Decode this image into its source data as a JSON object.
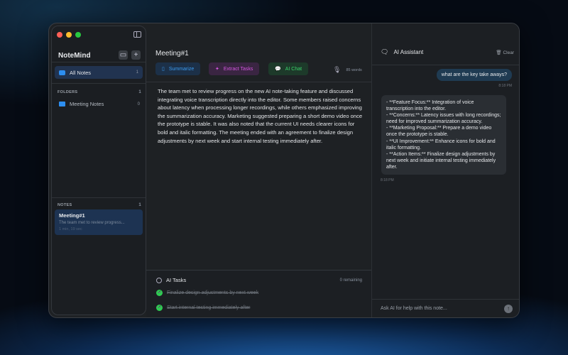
{
  "sidebar": {
    "app_name": "NoteMind",
    "all_notes": {
      "label": "All Notes",
      "count": "1"
    },
    "folders_header": "FOLDERS",
    "folders_count": "1",
    "folders": [
      {
        "label": "Meeting Notes",
        "count": "0"
      }
    ],
    "notes_header": "NOTES",
    "notes_count": "1",
    "notes": [
      {
        "title": "Meeting#1",
        "preview": "The team met to review progress...",
        "duration": "1 min, 19 sec"
      }
    ]
  },
  "main": {
    "title": "Meeting#1",
    "toolbar": {
      "summarize": "Summarize",
      "extract": "Extract Tasks",
      "chat": "AI Chat",
      "words": "85 words"
    },
    "body": "The team met to review progress on the new AI note-taking feature and discussed integrating voice transcription directly into the editor. Some members raised concerns about latency when processing longer recordings, while others emphasized improving the summarization accuracy. Marketing suggested preparing a short demo video once the prototype is stable. It was also noted that the current UI needs clearer icons for bold and italic formatting. The meeting ended with an agreement to finalize design adjustments by next week and start internal testing immediately after.",
    "tasks": {
      "title": "AI Tasks",
      "remaining": "0 remaining",
      "items": [
        "Finalize design adjustments by next week",
        "Start internal testing immediately after"
      ]
    }
  },
  "assistant": {
    "title": "AI Assistant",
    "clear": "Clear",
    "messages": [
      {
        "role": "user",
        "text": "what are the key take aways?",
        "time": "8:18 PM"
      },
      {
        "role": "assistant",
        "text": "- **Feature Focus:** Integration of voice transcription into the editor.\n- **Concerns:** Latency issues with long recordings; need for improved summarization accuracy.\n- **Marketing Proposal:** Prepare a demo video once the prototype is stable.\n- **UI Improvement:** Enhance icons for bold and italic formatting.\n- **Action Items:** Finalize design adjustments by next week and initiate internal testing immediately after.",
        "time": "8:18 PM"
      }
    ],
    "input_placeholder": "Ask AI for help with this note..."
  },
  "colors": {
    "accent": "#2d8ef0",
    "success": "#2ecc52",
    "extract": "#d457e0",
    "chat": "#3ad36a"
  }
}
